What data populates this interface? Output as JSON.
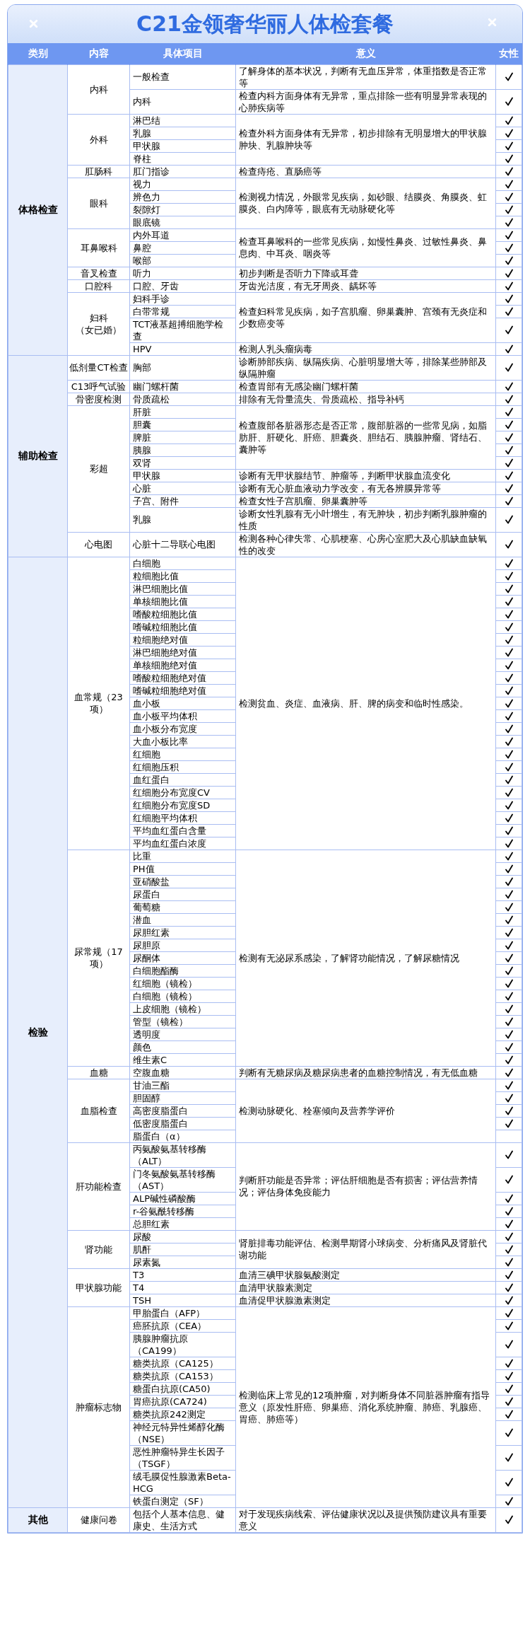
{
  "title": "C21金领奢华丽人体检套餐",
  "columns": [
    "类别",
    "内容",
    "具体项目",
    "意义",
    "女性"
  ],
  "categories": [
    {
      "name": "体格检查",
      "groups": [
        {
          "content": "内科",
          "sections": [
            {
              "meaning": "了解身体的基本状况，判断有无血压异常，体重指数是否正常等",
              "items": [
                {
                  "name": "一般检查",
                  "female": true
                }
              ]
            },
            {
              "meaning": "检查内科方面身体有无异常，重点排除一些有明显异常表现的心肺疾病等",
              "items": [
                {
                  "name": "内科",
                  "female": true
                }
              ]
            }
          ]
        },
        {
          "content": "外科",
          "sections": [
            {
              "meaning": "检查外科方面身体有无异常，初步排除有无明显增大的甲状腺肿块、乳腺肿块等",
              "items": [
                {
                  "name": "淋巴结",
                  "female": true
                },
                {
                  "name": "乳腺",
                  "female": true
                },
                {
                  "name": "甲状腺",
                  "female": true
                },
                {
                  "name": "脊柱",
                  "female": true
                }
              ]
            }
          ]
        },
        {
          "content": "肛肠科",
          "sections": [
            {
              "meaning": "检查痔疮、直肠癌等",
              "items": [
                {
                  "name": "肛门指诊",
                  "female": true
                }
              ]
            }
          ]
        },
        {
          "content": "眼科",
          "sections": [
            {
              "meaning": "检测视力情况，外眼常见疾病，如砂眼、结膜炎、角膜炎、虹膜炎、白内障等，眼底有无动脉硬化等",
              "items": [
                {
                  "name": "视力",
                  "female": true
                },
                {
                  "name": "辨色力",
                  "female": true
                },
                {
                  "name": "裂隙灯",
                  "female": true
                },
                {
                  "name": "眼底镜",
                  "female": true
                }
              ]
            }
          ]
        },
        {
          "content": "耳鼻喉科",
          "sections": [
            {
              "meaning": "检查耳鼻喉科的一些常见疾病，如慢性鼻炎、过敏性鼻炎、鼻息肉、中耳炎、咽炎等",
              "items": [
                {
                  "name": "内外耳道",
                  "female": true
                },
                {
                  "name": "鼻腔",
                  "female": true
                },
                {
                  "name": "喉部",
                  "female": true
                }
              ]
            }
          ]
        },
        {
          "content": "音叉检查",
          "sections": [
            {
              "meaning": "初步判断是否听力下降或耳聋",
              "items": [
                {
                  "name": "听力",
                  "female": true
                }
              ]
            }
          ]
        },
        {
          "content": "口腔科",
          "sections": [
            {
              "meaning": "牙齿光洁度，有无牙周炎、龋坏等",
              "items": [
                {
                  "name": "口腔、牙齿",
                  "female": true
                }
              ]
            }
          ]
        },
        {
          "content": "妇科",
          "note": "（女已婚）",
          "sections": [
            {
              "meaning": "检查妇科常见疾病，如子宫肌瘤、卵巢囊肿、宫颈有无炎症和少数癌变等",
              "items": [
                {
                  "name": "妇科手诊",
                  "female": true
                },
                {
                  "name": "白带常规",
                  "female": true
                },
                {
                  "name": "TCT液基超搏细胞学检查",
                  "female": true
                }
              ]
            },
            {
              "meaning": "检测人乳头瘤病毒",
              "items": [
                {
                  "name": "HPV",
                  "female": true
                }
              ]
            }
          ]
        }
      ]
    },
    {
      "name": "辅助检查",
      "groups": [
        {
          "content": "低剂量CT检查",
          "sections": [
            {
              "meaning": "诊断肺部疾病、纵隔疾病、心脏明显增大等，排除某些肺部及纵隔肿瘤",
              "items": [
                {
                  "name": "胸部",
                  "female": true
                }
              ]
            }
          ]
        },
        {
          "content": "C13呼气试验",
          "sections": [
            {
              "meaning": "检查胃部有无感染幽门螺杆菌",
              "items": [
                {
                  "name": "幽门螺杆菌",
                  "female": true
                }
              ]
            }
          ]
        },
        {
          "content": "骨密度检测",
          "sections": [
            {
              "meaning": "排除有无骨量流失、骨质疏松、指导补钙",
              "items": [
                {
                  "name": "骨质疏松",
                  "female": true
                }
              ]
            }
          ]
        },
        {
          "content": "彩超",
          "sections": [
            {
              "meaning": "检查腹部各脏器形态是否正常，腹部脏器的一些常见病，如脂肪肝、肝硬化、肝癌、胆囊炎、胆结石、胰腺肿瘤、肾结石、囊肿等",
              "items": [
                {
                  "name": "肝脏",
                  "female": true
                },
                {
                  "name": "胆囊",
                  "female": true
                },
                {
                  "name": "脾脏",
                  "female": true
                },
                {
                  "name": "胰腺",
                  "female": true
                },
                {
                  "name": "双肾",
                  "female": true
                }
              ]
            },
            {
              "meaning": "诊断有无甲状腺结节、肿瘤等，判断甲状腺血流变化",
              "items": [
                {
                  "name": "甲状腺",
                  "female": true
                }
              ]
            },
            {
              "meaning": "诊断有无心脏血液动力学改变，有无各辨膜异常等",
              "items": [
                {
                  "name": "心脏",
                  "female": true
                }
              ]
            },
            {
              "meaning": "检查女性子宫肌瘤、卵巢囊肿等",
              "items": [
                {
                  "name": "子宫、附件",
                  "female": true
                }
              ]
            },
            {
              "meaning": "诊断女性乳腺有无小叶增生，有无肿块，初步判断乳腺肿瘤的性质",
              "items": [
                {
                  "name": "乳腺",
                  "female": true
                }
              ]
            }
          ]
        },
        {
          "content": "心电图",
          "sections": [
            {
              "meaning": "检测各种心律失常、心肌梗塞、心房心室肥大及心肌缺血缺氧性的改变",
              "items": [
                {
                  "name": "心脏十二导联心电图",
                  "female": true
                }
              ]
            }
          ]
        }
      ]
    },
    {
      "name": "检验",
      "groups": [
        {
          "content": "血常规（23项）",
          "sections": [
            {
              "meaning": "检测贫血、炎症、血液病、肝、脾的病变和临时性感染。",
              "items": [
                {
                  "name": "白细胞",
                  "female": true
                },
                {
                  "name": "粒细胞比值",
                  "female": true
                },
                {
                  "name": "淋巴细胞比值",
                  "female": true
                },
                {
                  "name": "单核细胞比值",
                  "female": true
                },
                {
                  "name": "嗜酸粒细胞比值",
                  "female": true
                },
                {
                  "name": "嗜碱粒细胞比值",
                  "female": true
                },
                {
                  "name": "粒细胞绝对值",
                  "female": true
                },
                {
                  "name": "淋巴细胞绝对值",
                  "female": true
                },
                {
                  "name": "单核细胞绝对值",
                  "female": true
                },
                {
                  "name": "嗜酸粒细胞绝对值",
                  "female": true
                },
                {
                  "name": "嗜碱粒细胞绝对值",
                  "female": true
                },
                {
                  "name": "血小板",
                  "female": true
                },
                {
                  "name": "血小板平均体积",
                  "female": true
                },
                {
                  "name": "血小板分布宽度",
                  "female": true
                },
                {
                  "name": "大血小板比率",
                  "female": true
                },
                {
                  "name": "红细胞",
                  "female": true
                },
                {
                  "name": "红细胞压积",
                  "female": true
                },
                {
                  "name": "血红蛋白",
                  "female": true
                },
                {
                  "name": "红细胞分布宽度CV",
                  "female": true
                },
                {
                  "name": "红细胞分布宽度SD",
                  "female": true
                },
                {
                  "name": "红细胞平均体积",
                  "female": true
                },
                {
                  "name": "平均血红蛋白含量",
                  "female": true
                },
                {
                  "name": "平均血红蛋白浓度",
                  "female": true
                }
              ]
            }
          ]
        },
        {
          "content": "尿常规（17项）",
          "sections": [
            {
              "meaning": "检测有无泌尿系感染，了解肾功能情况，了解尿糖情况",
              "items": [
                {
                  "name": "比重",
                  "female": true
                },
                {
                  "name": "PH值",
                  "female": true
                },
                {
                  "name": "亚硝酸盐",
                  "female": true
                },
                {
                  "name": "尿蛋白",
                  "female": true
                },
                {
                  "name": "葡萄糖",
                  "female": true
                },
                {
                  "name": "潜血",
                  "female": true
                },
                {
                  "name": "尿胆红素",
                  "female": true
                },
                {
                  "name": "尿胆原",
                  "female": true
                },
                {
                  "name": "尿酮体",
                  "female": true
                },
                {
                  "name": "白细胞酯酶",
                  "female": true
                },
                {
                  "name": "红细胞（镜检）",
                  "female": true
                },
                {
                  "name": "白细胞（镜检）",
                  "female": true
                },
                {
                  "name": "上皮细胞（镜检）",
                  "female": true
                },
                {
                  "name": "管型（镜检）",
                  "female": true
                },
                {
                  "name": "透明度",
                  "female": true
                },
                {
                  "name": "颜色",
                  "female": true
                },
                {
                  "name": "维生素C",
                  "female": true
                }
              ]
            }
          ]
        },
        {
          "content": "血糖",
          "sections": [
            {
              "meaning": "判断有无糖尿病及糖尿病患者的血糖控制情况，有无低血糖",
              "items": [
                {
                  "name": "空腹血糖",
                  "female": true
                }
              ]
            }
          ]
        },
        {
          "content": "血脂检查",
          "sections": [
            {
              "meaning": "检测动脉硬化、栓塞倾向及营养学评价",
              "items": [
                {
                  "name": "甘油三酯",
                  "female": true
                },
                {
                  "name": "胆固醇",
                  "female": true
                },
                {
                  "name": "高密度脂蛋白",
                  "female": true
                },
                {
                  "name": "低密度脂蛋白",
                  "female": true
                },
                {
                  "name": "脂蛋白（α）",
                  "female": false
                }
              ]
            }
          ]
        },
        {
          "content": "肝功能检查",
          "sections": [
            {
              "meaning": "判断肝功能是否异常；评估肝细胞是否有损害；评估营养情况；评估身体免疫能力",
              "items": [
                {
                  "name": "丙氨酸氨基转移酶（ALT）",
                  "female": true
                },
                {
                  "name": "门冬氨酸氨基转移酶（AST）",
                  "female": true
                },
                {
                  "name": "ALP碱性磷酸酶",
                  "female": true
                },
                {
                  "name": "r-谷氨酰转移酶",
                  "female": true
                },
                {
                  "name": "总胆红素",
                  "female": true
                }
              ]
            }
          ]
        },
        {
          "content": "肾功能",
          "sections": [
            {
              "meaning": "肾脏排毒功能评估、检测早期肾小球病变、分析痛风及肾脏代谢功能",
              "items": [
                {
                  "name": "尿酸",
                  "female": true
                },
                {
                  "name": "肌酐",
                  "female": true
                },
                {
                  "name": "尿素氮",
                  "female": true
                }
              ]
            }
          ]
        },
        {
          "content": "甲状腺功能",
          "sections": [
            {
              "meaning": "血清三碘甲状腺氨酸测定",
              "items": [
                {
                  "name": "T3",
                  "female": true
                }
              ]
            },
            {
              "meaning": "血清甲状腺素测定",
              "items": [
                {
                  "name": "T4",
                  "female": true
                }
              ]
            },
            {
              "meaning": "血清促甲状腺激素测定",
              "items": [
                {
                  "name": "TSH",
                  "female": true
                }
              ]
            }
          ]
        },
        {
          "content": "肿瘤标志物",
          "sections": [
            {
              "meaning": "检测临床上常见的12项肿瘤，对判断身体不同脏器肿瘤有指导意义（原发性肝癌、卵巢癌、消化系统肿瘤、肺癌、乳腺癌、胃癌、肺癌等）",
              "items": [
                {
                  "name": "甲胎蛋白（AFP）",
                  "female": true
                },
                {
                  "name": "癌胚抗原（CEA）",
                  "female": true
                },
                {
                  "name": "胰腺肿瘤抗原（CA199）",
                  "female": true
                },
                {
                  "name": "糖类抗原（CA125）",
                  "female": true
                },
                {
                  "name": "糖类抗原（CA153）",
                  "female": true
                },
                {
                  "name": "糖蛋白抗原(CA50)",
                  "female": true
                },
                {
                  "name": "胃癌抗原(CA724)",
                  "female": true
                },
                {
                  "name": "糖类抗原242测定",
                  "female": true
                },
                {
                  "name": "神经元特异性烯醇化酶（NSE）",
                  "female": true
                },
                {
                  "name": "恶性肿瘤特异生长因子（TSGF）",
                  "female": true
                },
                {
                  "name": "绒毛膜促性腺激素Beta-HCG",
                  "female": true
                },
                {
                  "name": "铁蛋白测定（SF）",
                  "female": true
                }
              ]
            }
          ]
        }
      ]
    },
    {
      "name": "其他",
      "groups": [
        {
          "content": "健康问卷",
          "sections": [
            {
              "meaning": "对于发现疾病线索、评估健康状况以及提供预防建议具有重要意义",
              "items": [
                {
                  "name": "包括个人基本信息、健康史、生活方式",
                  "female": true
                }
              ]
            }
          ]
        }
      ]
    }
  ]
}
